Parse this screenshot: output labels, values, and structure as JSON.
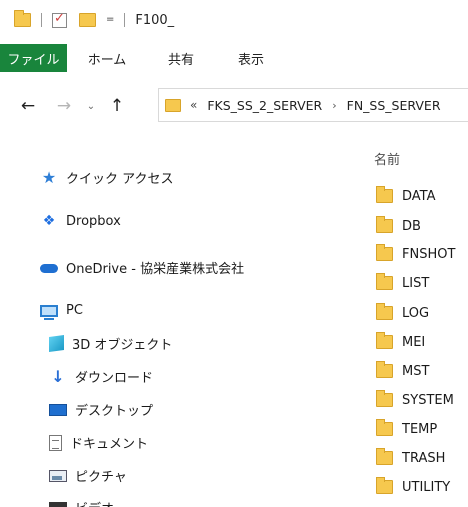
{
  "window": {
    "title": "F100_",
    "quick_access_dropdown": "="
  },
  "ribbon": {
    "tabs": [
      "ファイル",
      "ホーム",
      "共有",
      "表示"
    ],
    "active_color": "#19853c"
  },
  "navigation": {
    "back": "←",
    "forward": "→",
    "recent": "⌄",
    "up": "↑",
    "overflow": "«",
    "breadcrumbs": [
      "FKS_SS_2_SERVER",
      "FN_SS_SERVER"
    ],
    "separator": "›"
  },
  "sidebar": {
    "items": [
      {
        "label": "クイック アクセス",
        "icon": "star-icon"
      },
      {
        "label": "Dropbox",
        "icon": "dropbox-icon"
      },
      {
        "label": "OneDrive - 協栄産業株式会社",
        "icon": "cloud-icon"
      },
      {
        "label": "PC",
        "icon": "pc-icon"
      },
      {
        "label": "3D オブジェクト",
        "icon": "cube-icon"
      },
      {
        "label": "ダウンロード",
        "icon": "download-icon"
      },
      {
        "label": "デスクトップ",
        "icon": "desktop-icon"
      },
      {
        "label": "ドキュメント",
        "icon": "document-icon"
      },
      {
        "label": "ピクチャ",
        "icon": "picture-icon"
      },
      {
        "label": "ビデオ",
        "icon": "video-icon"
      }
    ]
  },
  "content": {
    "column_header": "名前",
    "folders": [
      "DATA",
      "DB",
      "FNSHOT",
      "LIST",
      "LOG",
      "MEI",
      "MST",
      "SYSTEM",
      "TEMP",
      "TRASH",
      "UTILITY"
    ]
  }
}
